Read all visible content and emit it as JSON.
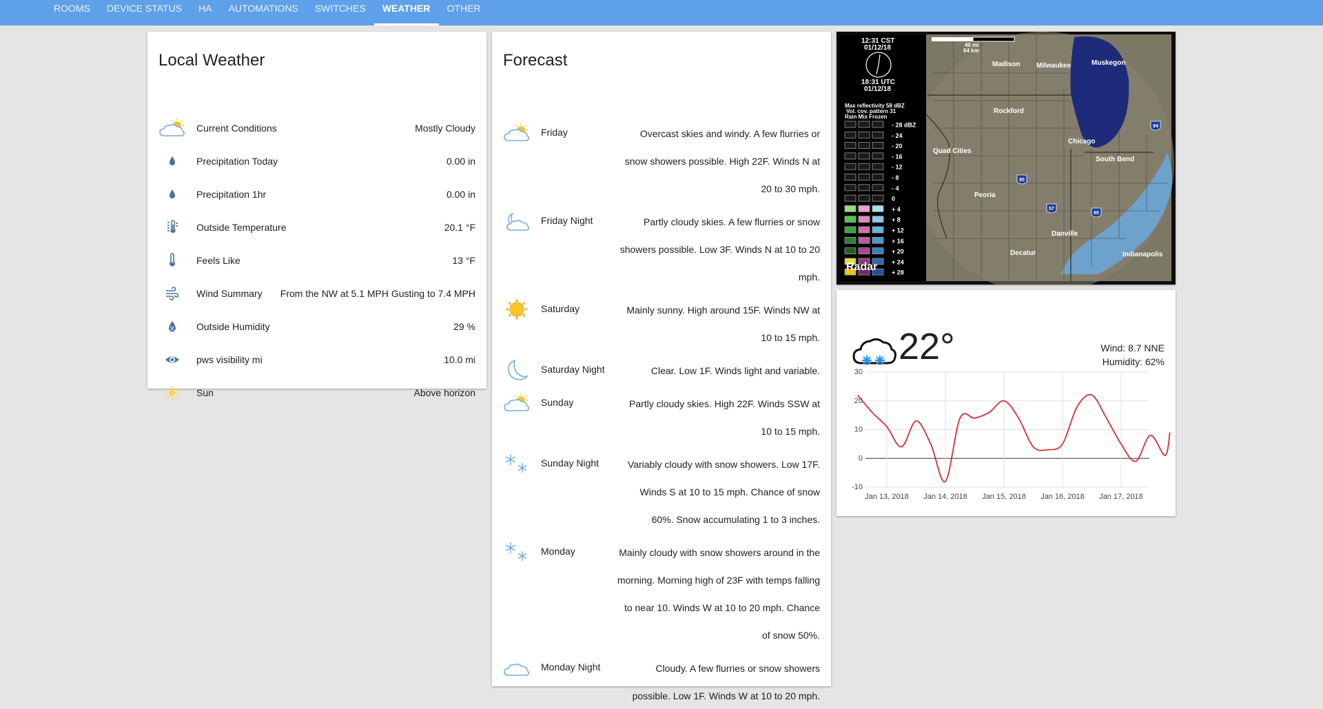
{
  "nav": {
    "tabs": [
      {
        "label": "ROOMS",
        "active": false
      },
      {
        "label": "DEVICE STATUS",
        "active": false
      },
      {
        "label": "HA",
        "active": false
      },
      {
        "label": "AUTOMATIONS",
        "active": false
      },
      {
        "label": "SWITCHES",
        "active": false
      },
      {
        "label": "WEATHER",
        "active": true
      },
      {
        "label": "OTHER",
        "active": false
      }
    ],
    "accent": "#5fa0ea"
  },
  "local_weather": {
    "title": "Local Weather",
    "rows": [
      {
        "icon": "partly-cloudy-icon",
        "label": "Current Conditions",
        "value": "Mostly Cloudy"
      },
      {
        "icon": "water-drop-icon",
        "label": "Precipitation Today",
        "value": "0.00 in"
      },
      {
        "icon": "water-drop-icon",
        "label": "Precipitation 1hr",
        "value": "0.00 in"
      },
      {
        "icon": "thermometer-lines-icon",
        "label": "Outside Temperature",
        "value": "20.1 °F"
      },
      {
        "icon": "thermometer-icon",
        "label": "Feels Like",
        "value": "13 °F"
      },
      {
        "icon": "wind-icon",
        "label": "Wind Summary",
        "value": "From the NW at 5.1 MPH Gusting to 7.4 MPH"
      },
      {
        "icon": "humidity-icon",
        "label": "Outside Humidity",
        "value": "29 %"
      },
      {
        "icon": "eye-icon",
        "label": "pws visibility mi",
        "value": "10.0 mi"
      },
      {
        "icon": "sun-icon",
        "label": "Sun",
        "value": "Above horizon"
      }
    ]
  },
  "forecast": {
    "title": "Forecast",
    "days": [
      {
        "icon": "partly-cloudy-day-icon",
        "day": "Friday",
        "desc": "Overcast skies and windy. A few flurries or snow showers possible. High 22F. Winds N at 20 to 30 mph."
      },
      {
        "icon": "partly-cloudy-night-icon",
        "day": "Friday Night",
        "desc": "Partly cloudy skies. A few flurries or snow showers possible. Low 3F. Winds N at 10 to 20 mph."
      },
      {
        "icon": "sunny-icon",
        "day": "Saturday",
        "desc": "Mainly sunny. High around 15F. Winds NW at 10 to 15 mph."
      },
      {
        "icon": "moon-icon",
        "day": "Saturday Night",
        "desc": "Clear. Low 1F. Winds light and variable."
      },
      {
        "icon": "partly-cloudy-day-icon",
        "day": "Sunday",
        "desc": "Partly cloudy skies. High 22F. Winds SSW at 10 to 15 mph."
      },
      {
        "icon": "snowflakes-icon",
        "day": "Sunday Night",
        "desc": "Variably cloudy with snow showers. Low 17F. Winds S at 10 to 15 mph. Chance of snow 60%. Snow accumulating 1 to 3 inches."
      },
      {
        "icon": "snowflakes-icon",
        "day": "Monday",
        "desc": "Mainly cloudy with snow showers around in the morning. Morning high of 23F with temps falling to near 10. Winds W at 10 to 20 mph. Chance of snow 50%."
      },
      {
        "icon": "cloud-icon",
        "day": "Monday Night",
        "desc": "Cloudy. A few flurries or snow showers possible. Low 1F. Winds W at 10 to 20 mph."
      }
    ]
  },
  "radar": {
    "label": "Radar",
    "time_local": "12:31 CST",
    "date_local": "01/12/18",
    "time_utc": "18:31 UTC",
    "date_utc": "01/12/18",
    "scale_mi": "40 mi",
    "scale_km": "64 km",
    "max_reflectivity": "Max reflectivity 58 dBZ",
    "vcp": "Vol. cov. pattern 31",
    "legend_header": "Rain Mix Frozen",
    "legend_unit": "dBZ",
    "legend_levels": [
      "28",
      "24",
      "20",
      "16",
      "12",
      "8",
      "4",
      "0",
      "4",
      "8",
      "12",
      "16",
      "20",
      "24",
      "28"
    ],
    "cities": [
      "Madison",
      "Milwaukee",
      "Muskegon",
      "Rockford",
      "Chicago",
      "Quad Cities",
      "South Bend",
      "Peoria",
      "Danville",
      "Decatur",
      "Indianapolis"
    ],
    "highways": [
      "80",
      "57",
      "65",
      "94"
    ]
  },
  "temperature": {
    "current": "22°",
    "wind": "Wind: 8.7 NNE",
    "humidity": "Humidity: 62%",
    "icon": "snow-cloud-icon"
  },
  "chart_data": {
    "type": "line",
    "x_ticks": [
      "Jan 13, 2018",
      "Jan 14, 2018",
      "Jan 15, 2018",
      "Jan 16, 2018",
      "Jan 17, 2018"
    ],
    "x": [
      "Jan 12, 2018 12:00",
      "Jan 12, 2018 18:00",
      "Jan 13, 2018 00:00",
      "Jan 13, 2018 06:00",
      "Jan 13, 2018 12:00",
      "Jan 13, 2018 18:00",
      "Jan 14, 2018 00:00",
      "Jan 14, 2018 06:00",
      "Jan 14, 2018 12:00",
      "Jan 14, 2018 18:00",
      "Jan 15, 2018 00:00",
      "Jan 15, 2018 06:00",
      "Jan 15, 2018 12:00",
      "Jan 15, 2018 18:00",
      "Jan 16, 2018 00:00",
      "Jan 16, 2018 06:00",
      "Jan 16, 2018 12:00",
      "Jan 16, 2018 18:00",
      "Jan 17, 2018 00:00",
      "Jan 17, 2018 06:00",
      "Jan 17, 2018 12:00",
      "Jan 17, 2018 18:00",
      "Jan 17, 2018 20:00"
    ],
    "series": [
      {
        "values": [
          22,
          16,
          11,
          4,
          13,
          5,
          -8,
          14,
          14,
          16,
          20,
          14,
          4,
          3,
          5,
          18,
          22,
          14,
          5,
          -1,
          8,
          1,
          9
        ]
      }
    ],
    "ylim": [
      -10,
      30
    ],
    "y_ticks": [
      "30",
      "20",
      "10",
      "0",
      "-10"
    ],
    "grid": true,
    "line_color": "#d32f2f"
  }
}
